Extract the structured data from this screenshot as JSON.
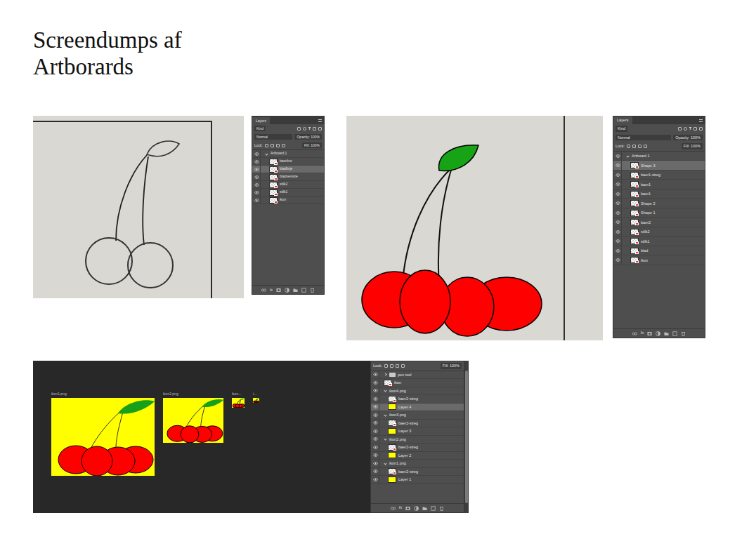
{
  "title": "Screendumps af Artborards",
  "figures": [
    {
      "photo": {
        "kind": "sketch"
      },
      "panel": {
        "tab": "Layers",
        "filter": "Kind",
        "filter_glyph": "T",
        "blend": "Normal",
        "opacity": "Opacity: 100%",
        "lock": "Lock:",
        "fill": "Fill: 100%",
        "footer": "fx",
        "layers": [
          {
            "name": "Artboard 1",
            "kind": "group",
            "expanded": true,
            "selected": false
          },
          {
            "name": "baerline",
            "kind": "layer",
            "selected": false
          },
          {
            "name": "bladlinje",
            "kind": "layer",
            "selected": true
          },
          {
            "name": "bladvenstre",
            "kind": "layer",
            "selected": false
          },
          {
            "name": "stilk2",
            "kind": "layer",
            "selected": false
          },
          {
            "name": "stilk1",
            "kind": "layer",
            "selected": false
          },
          {
            "name": "ikon",
            "kind": "layer",
            "selected": false
          }
        ]
      }
    },
    {
      "photo": {
        "kind": "colored"
      },
      "panel": {
        "tab": "Layers",
        "filter": "Kind",
        "filter_glyph": "T",
        "blend": "Normal",
        "opacity": "Opacity: 100%",
        "lock": "Lock:",
        "fill": "Fill: 100%",
        "footer": "fx",
        "layers": [
          {
            "name": "Artboard 1",
            "kind": "group",
            "expanded": true,
            "selected": false
          },
          {
            "name": "Shape 3",
            "kind": "layer",
            "selected": true
          },
          {
            "name": "baer1-streg",
            "kind": "layer",
            "selected": false
          },
          {
            "name": "baer1",
            "kind": "layer",
            "selected": false
          },
          {
            "name": "baer1",
            "kind": "layer",
            "selected": false
          },
          {
            "name": "Shape 2",
            "kind": "layer",
            "selected": false
          },
          {
            "name": "Shape 1",
            "kind": "layer",
            "selected": false
          },
          {
            "name": "baer2",
            "kind": "layer",
            "selected": false
          },
          {
            "name": "stilk2",
            "kind": "layer",
            "selected": false
          },
          {
            "name": "stilk1",
            "kind": "layer",
            "selected": false
          },
          {
            "name": "blad",
            "kind": "layer",
            "selected": false
          },
          {
            "name": "ikon",
            "kind": "layer",
            "selected": false
          }
        ]
      }
    }
  ],
  "artboards_view": {
    "artboards": [
      {
        "label": "ikon1.png"
      },
      {
        "label": "ikon2.png"
      },
      {
        "label": "ikon..."
      },
      {
        "label": "i..."
      }
    ],
    "panel": {
      "lock": "Lock:",
      "fill": "Fill: 100%",
      "footer": "fx",
      "layers": [
        {
          "name": "pen tool",
          "kind": "folder",
          "expanded": false,
          "selected": false
        },
        {
          "name": "ikon",
          "kind": "layer",
          "selected": false
        },
        {
          "name": "ikon4.png",
          "kind": "group",
          "expanded": true,
          "selected": false
        },
        {
          "name": "baer2-streg",
          "kind": "layer",
          "selected": false
        },
        {
          "name": "Layer 4",
          "kind": "fill",
          "selected": true
        },
        {
          "name": "ikon3.png",
          "kind": "group",
          "expanded": true,
          "selected": false
        },
        {
          "name": "baer2-streg",
          "kind": "layer",
          "selected": false
        },
        {
          "name": "Layer 3",
          "kind": "fill",
          "selected": false
        },
        {
          "name": "ikon2.png",
          "kind": "group",
          "expanded": true,
          "selected": false
        },
        {
          "name": "baer2-streg",
          "kind": "layer",
          "selected": false
        },
        {
          "name": "Layer 2",
          "kind": "fill",
          "selected": false
        },
        {
          "name": "ikon1.png",
          "kind": "group",
          "expanded": true,
          "selected": false
        },
        {
          "name": "baer2-streg",
          "kind": "layer",
          "selected": false
        },
        {
          "name": "Layer 1",
          "kind": "fill",
          "selected": false
        }
      ]
    }
  }
}
